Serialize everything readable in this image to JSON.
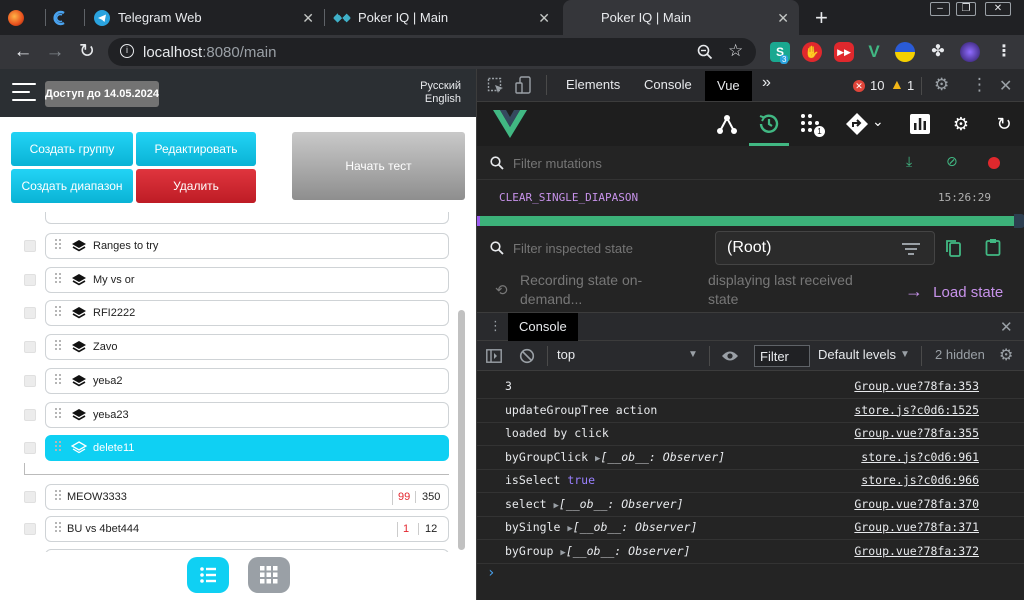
{
  "browser": {
    "tabs": [
      {
        "title": "",
        "favicon": "firefox-like-icon"
      },
      {
        "title": "",
        "favicon": "refresh-c-icon"
      },
      {
        "title": "Telegram Web",
        "favicon": "telegram-icon"
      },
      {
        "title": "Poker IQ | Main",
        "favicon": "poker-iq-icon"
      },
      {
        "title": "Poker IQ | Main",
        "favicon": "poker-iq-icon",
        "active": true
      }
    ],
    "new_tab": "+",
    "url_host": "localhost",
    "url_path": ":8080/main",
    "extension_badge": "3"
  },
  "app": {
    "access_badge": "Доступ до 14.05.2024",
    "languages": [
      "Русский",
      "English"
    ],
    "buttons": {
      "create_group": "Создать группу",
      "edit": "Редактировать",
      "create_range": "Создать диапазон",
      "delete": "Удалить",
      "start_test": "Начать тест"
    },
    "tree_items": [
      {
        "label": "Ranges to try"
      },
      {
        "label": "My vs or"
      },
      {
        "label": "RFI2222"
      },
      {
        "label": "Zavo"
      },
      {
        "label": "уеьа2"
      },
      {
        "label": "уеьа23"
      },
      {
        "label": "delete11",
        "selected": true
      }
    ],
    "ranges": [
      {
        "label": "MEOW3333",
        "count_a": "99",
        "count_b": "350"
      },
      {
        "label": "BU vs 4bet444",
        "count_a": "1",
        "count_b": "12"
      }
    ],
    "colors": {
      "accent": "#0fd0f3",
      "danger": "#d3262f",
      "header": "#2b2f33"
    }
  },
  "devtools": {
    "tabs": [
      "Elements",
      "Console",
      "Vue"
    ],
    "more": "»",
    "errors": "10",
    "warnings": "1",
    "vue": {
      "filter_mutations_placeholder": "Filter mutations",
      "mutation_name": "CLEAR_SINGLE_DIAPASON",
      "mutation_time": "15:26:29",
      "filter_state_placeholder": "Filter inspected state",
      "root_label": "(Root)",
      "recording_text": "Recording state on-demand...",
      "displaying_text": "displaying last received state",
      "load_state": "Load state",
      "timeline_badge": "1"
    },
    "console": {
      "drawer_tab": "Console",
      "context": "top",
      "filter_placeholder": "Filter",
      "levels": "Default levels",
      "hidden": "2 hidden",
      "logs": [
        {
          "text": "3",
          "source": "Group.vue?78fa:353"
        },
        {
          "text": "updateGroupTree action",
          "source": "store.js?c0d6:1525"
        },
        {
          "text": "loaded by click",
          "source": "Group.vue?78fa:355"
        },
        {
          "text": "byGroupClick",
          "obj": "[__ob__: Observer]",
          "source": "store.js?c0d6:961"
        },
        {
          "text": "isSelect",
          "bool": "true",
          "source": "store.js?c0d6:966"
        },
        {
          "text": "select",
          "obj": "[__ob__: Observer]",
          "source": "Group.vue?78fa:370"
        },
        {
          "text": "bySingle",
          "obj": "[__ob__: Observer]",
          "source": "Group.vue?78fa:371"
        },
        {
          "text": "byGroup",
          "obj": "[__ob__: Observer]",
          "source": "Group.vue?78fa:372"
        }
      ],
      "prompt": "›"
    }
  }
}
